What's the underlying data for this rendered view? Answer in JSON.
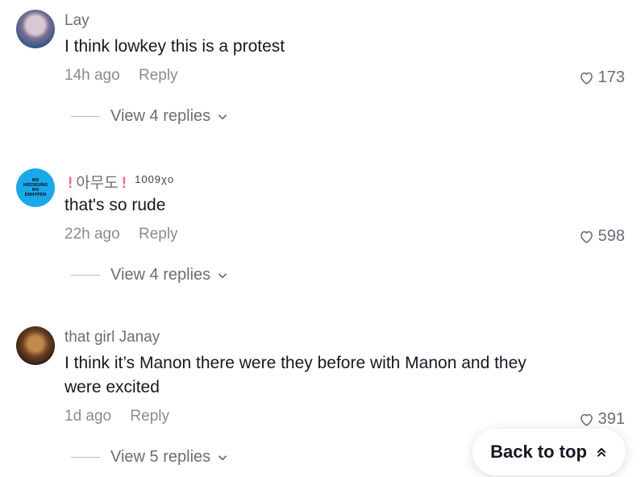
{
  "comments": [
    {
      "username": "Lay",
      "text": "I think lowkey this is a protest",
      "time": "14h ago",
      "reply_label": "Reply",
      "likes": "173",
      "view_replies": "View 4 replies"
    },
    {
      "username_main": "아무도",
      "username_excl": "!",
      "username_suffix": "1009χo",
      "avatar_text": "NO HEESEUNG NO ENHYPEN",
      "text": "that's so rude",
      "time": "22h ago",
      "reply_label": "Reply",
      "likes": "598",
      "view_replies": "View 4 replies"
    },
    {
      "username": "that girl Janay",
      "text": "I think it’s Manon there were they before with Manon and they were excited",
      "time": "1d ago",
      "reply_label": "Reply",
      "likes": "391",
      "view_replies": "View 5 replies"
    }
  ],
  "back_to_top": {
    "label": "Back to top"
  },
  "colors": {
    "text_primary": "#161823",
    "text_secondary": "#8a8b91",
    "accent_pink": "#f06a8c",
    "avatar_blue": "#1aa8e8"
  },
  "icons": {
    "like": "heart-outline-icon",
    "expand": "chevron-down-icon",
    "back_to_top": "double-chevron-up-icon"
  }
}
